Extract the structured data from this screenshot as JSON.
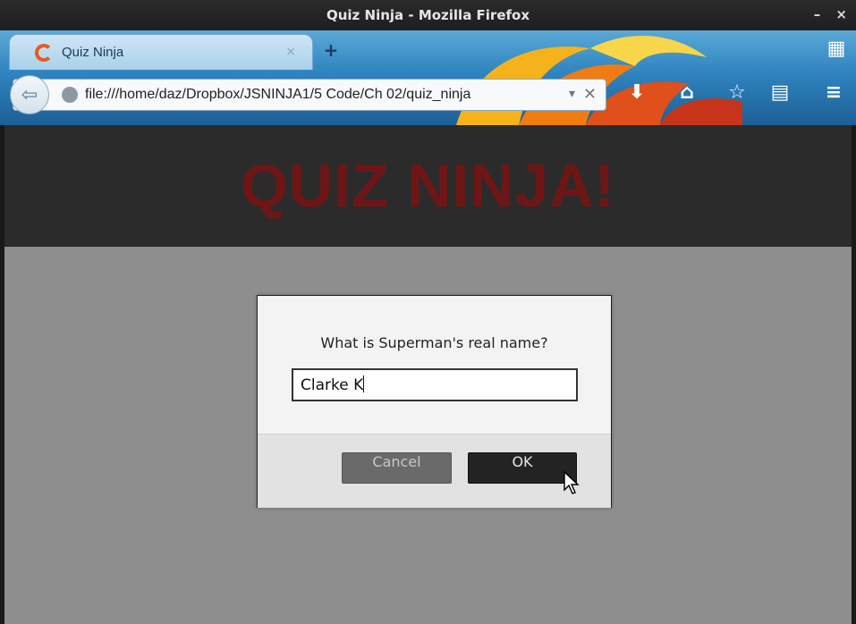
{
  "window": {
    "title": "Quiz Ninja - Mozilla Firefox",
    "wm_buttons": "– ×"
  },
  "tabs": [
    {
      "label": "Quiz Ninja",
      "close": "×"
    }
  ],
  "newtab_label": "+",
  "urlbar": {
    "value": "file:///home/daz/Dropbox/JSNINJA1/5 Code/Ch 02/quiz_ninja",
    "dropdown": "▾",
    "clear": "✕"
  },
  "toolbar": {
    "download": "⬇",
    "home": "⌂",
    "bookmark": "☆",
    "reader": "▤",
    "menu": "≡"
  },
  "page": {
    "title": "QUIZ NINJA!"
  },
  "dialog": {
    "message": "What is Superman's real name?",
    "input_value": "Clarke K",
    "cancel_label": "Cancel",
    "ok_label": "OK"
  },
  "colors": {
    "title_red": "#6e1616",
    "header_bg": "#2b2b2b",
    "page_bg": "#8e8e8e"
  }
}
